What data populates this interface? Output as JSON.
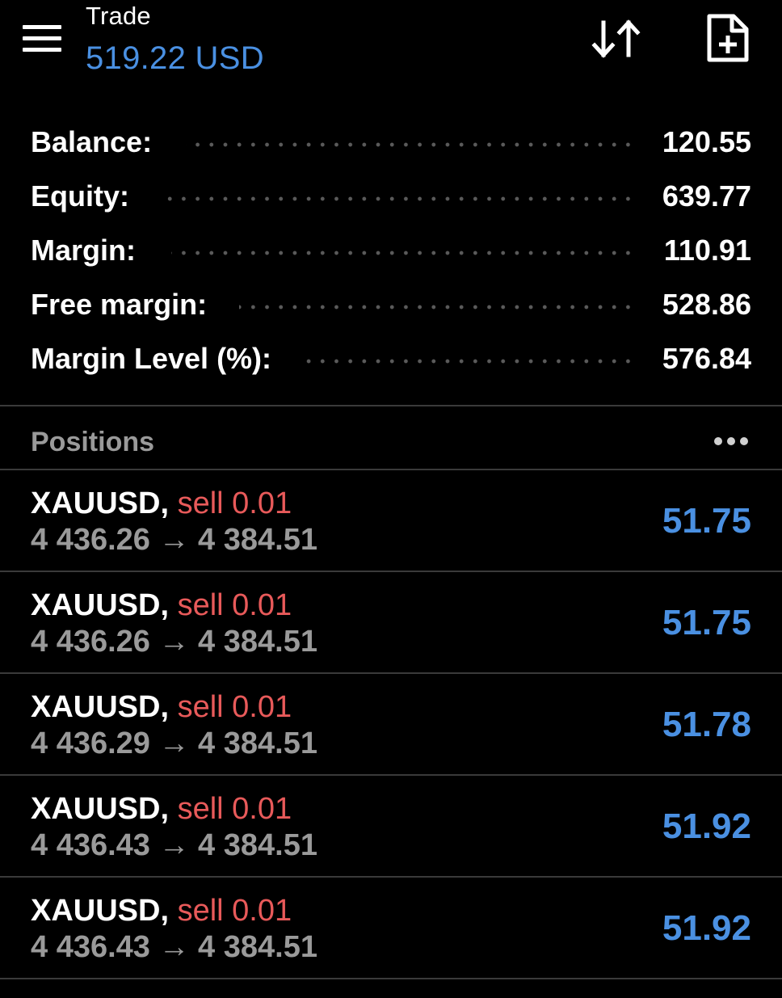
{
  "header": {
    "title": "Trade",
    "subtitle": "519.22 USD"
  },
  "account": [
    {
      "label": "Balance:",
      "value": "120.55"
    },
    {
      "label": "Equity:",
      "value": "639.77"
    },
    {
      "label": "Margin:",
      "value": "110.91"
    },
    {
      "label": "Free margin:",
      "value": "528.86"
    },
    {
      "label": "Margin Level (%):",
      "value": "576.84"
    }
  ],
  "positions": {
    "title": "Positions",
    "items": [
      {
        "symbol": "XAUUSD,",
        "side": "sell 0.01",
        "open_price": "4 436.26",
        "arrow": "→",
        "current_price": "4 384.51",
        "profit": "51.75"
      },
      {
        "symbol": "XAUUSD,",
        "side": "sell 0.01",
        "open_price": "4 436.26",
        "arrow": "→",
        "current_price": "4 384.51",
        "profit": "51.75"
      },
      {
        "symbol": "XAUUSD,",
        "side": "sell 0.01",
        "open_price": "4 436.29",
        "arrow": "→",
        "current_price": "4 384.51",
        "profit": "51.78"
      },
      {
        "symbol": "XAUUSD,",
        "side": "sell 0.01",
        "open_price": "4 436.43",
        "arrow": "→",
        "current_price": "4 384.51",
        "profit": "51.92"
      },
      {
        "symbol": "XAUUSD,",
        "side": "sell 0.01",
        "open_price": "4 436.43",
        "arrow": "→",
        "current_price": "4 384.51",
        "profit": "51.92"
      }
    ]
  },
  "icons": {
    "menu": "hamburger-menu-icon",
    "sort": "sort-arrows-icon",
    "new_order": "new-document-plus-icon",
    "more": "more-horizontal-icon"
  },
  "colors": {
    "background": "#000000",
    "accent_blue": "#4a90e2",
    "sell_red": "#e85a5a",
    "muted_text": "#9a9a9a",
    "divider": "#3a3a3a"
  }
}
